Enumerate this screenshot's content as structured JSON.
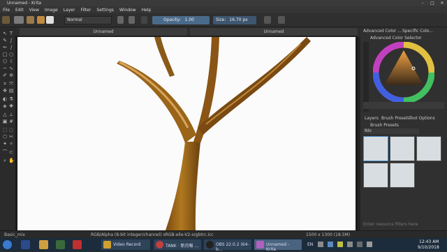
{
  "window": {
    "title": "Unnamed - Krita",
    "min": "–",
    "max": "□",
    "close": "✕"
  },
  "menu": [
    "File",
    "Edit",
    "View",
    "Image",
    "Layer",
    "Filter",
    "Settings",
    "Window",
    "Help"
  ],
  "toolbar": {
    "blend_mode": "Normal",
    "opacity_label": "Opacity:",
    "opacity_value": "1.00",
    "size_label": "Size:",
    "size_value": "16.70 px"
  },
  "document": {
    "tab_left": "Unnamed",
    "tab_right": "Unnamed"
  },
  "panels": {
    "color_tabs": [
      "Advanced Color ...",
      "Specific Colo..."
    ],
    "color_selector_title": "Advanced Color Selector",
    "layer_tabs": [
      "Layers",
      "Brush Presets",
      "Tool Options"
    ],
    "brush_presets_title": "Brush Presets",
    "brush_filter": "Nlo",
    "brush_search": "Enter resource filters here"
  },
  "status": {
    "brush": "Basic_mix",
    "color_info": "RGB/Alpha (8-bit integer/channel)  sRGB-elle-V2-srgbtrc.icc",
    "size_info": "1500 x 1300 (18.5M)"
  },
  "taskbar": {
    "items": [
      "Video Record",
      "TANK · 新月報 ...",
      "OBS 22.0.2 (64-b...",
      "Unnamed - Krita"
    ],
    "lang": "EN",
    "time": "12:43 AM",
    "date": "9/10/2018"
  },
  "colors": {
    "accent": "#4a6a8a",
    "tree_trunk": "#a0691e"
  }
}
